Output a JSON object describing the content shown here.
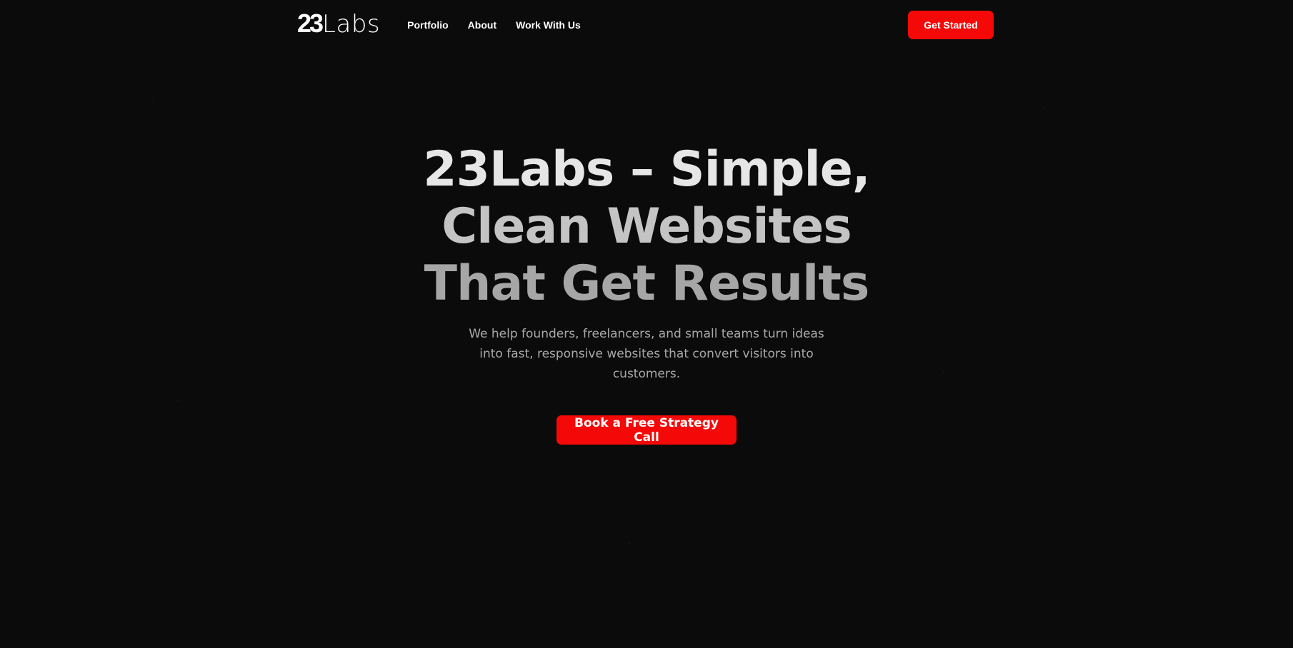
{
  "nav": {
    "logo_number": "23",
    "logo_word": "Labs",
    "links": [
      {
        "label": "Portfolio"
      },
      {
        "label": "About"
      },
      {
        "label": "Work With Us"
      }
    ],
    "cta_label": "Get Started"
  },
  "hero": {
    "title_line1": "23Labs – Simple,",
    "title_line2": "Clean Websites",
    "title_line3": "That Get Results",
    "subtitle": "We help founders, freelancers, and small teams turn ideas into fast, responsive websites that convert visitors into customers.",
    "cta_label": "Book a Free Strategy Call"
  },
  "colors": {
    "background": "#0b0b0b",
    "accent": "#f50808",
    "text": "#ffffff",
    "muted_text": "#a9a9a9"
  }
}
